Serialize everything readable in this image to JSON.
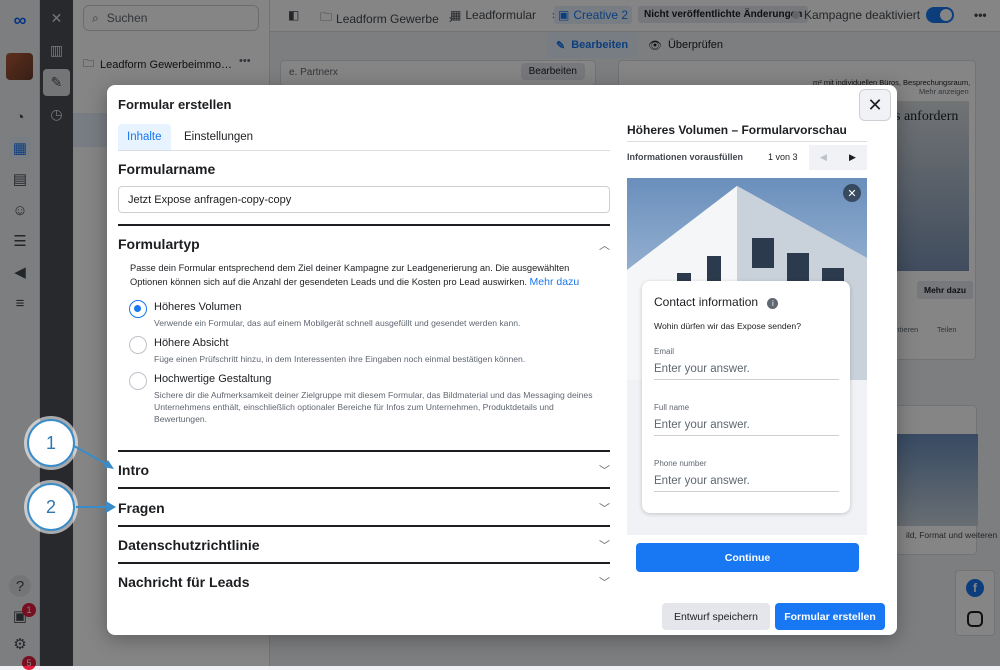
{
  "rail": {
    "badges": [
      "1",
      "5"
    ],
    "help": "?"
  },
  "tree": {
    "search_placeholder": "Suchen",
    "root_item": "Leadform Gewerbeimmo…",
    "more": "•••"
  },
  "topbar": {
    "crumb_campaign": "Leadform Gewerbe",
    "crumb_adset": "Leadformular",
    "crumb_ad": "Creative 2",
    "unpublished": "Nicht veröffentlichte Änderungen",
    "campaign_status": "Kampagne deaktiviert",
    "edit": "Bearbeiten",
    "review": "Überprüfen"
  },
  "background": {
    "headline_fragment": "s anfordern",
    "desc_fragment": "m² mit individuellen Büros, Besprechungsraum,",
    "more_link": "Mehr anzeigen",
    "cta": "Mehr dazu",
    "share": "Teilen",
    "comments": "mentieren",
    "footer_text": "ild, Format und weiteren",
    "left_card_btn": "Bearbeiten",
    "left_card_label": "e. Partnerx"
  },
  "modal": {
    "title": "Formular erstellen",
    "tabs": [
      "Inhalte",
      "Einstellungen"
    ],
    "form_name_title": "Formularname",
    "form_name_value": "Jetzt Expose anfragen-copy-copy",
    "form_type_title": "Formulartyp",
    "form_type_desc": "Passe dein Formular entsprechend dem Ziel deiner Kampagne zur Leadgenerierung an. Die ausgewählten Optionen können sich auf die Anzahl der gesendeten Leads und die Kosten pro Lead auswirken.",
    "more_link": "Mehr dazu",
    "options": [
      {
        "label": "Höheres Volumen",
        "desc": "Verwende ein Formular, das auf einem Mobilgerät schnell ausgefüllt und gesendet werden kann.",
        "selected": true
      },
      {
        "label": "Höhere Absicht",
        "desc": "Füge einen Prüfschritt hinzu, in dem Interessenten ihre Eingaben noch einmal bestätigen können.",
        "selected": false
      },
      {
        "label": "Hochwertige Gestaltung",
        "desc": "Sichere dir die Aufmerksamkeit deiner Zielgruppe mit diesem Formular, das Bildmaterial und das Messaging deines Unternehmens enthält, einschließlich optionaler Bereiche für Infos zum Unternehmen, Produktdetails und Bewertungen.",
        "selected": false
      }
    ],
    "sections": [
      "Intro",
      "Fragen",
      "Datenschutzrichtlinie",
      "Nachricht für Leads"
    ],
    "preview": {
      "title": "Höheres Volumen – Formularvorschau",
      "step": "Informationen vorausfüllen",
      "count": "1 von 3",
      "card_title": "Contact information",
      "card_question": "Wohin dürfen wir das Expose senden?",
      "fields": [
        {
          "label": "Email",
          "placeholder": "Enter your answer."
        },
        {
          "label": "Full name",
          "placeholder": "Enter your answer."
        },
        {
          "label": "Phone number",
          "placeholder": "Enter your answer."
        }
      ],
      "continue": "Continue"
    },
    "save_draft": "Entwurf speichern",
    "create": "Formular erstellen"
  },
  "annotations": [
    "1",
    "2"
  ],
  "colors": {
    "accent": "#1877f2",
    "annotation": "#3a8cc8"
  }
}
